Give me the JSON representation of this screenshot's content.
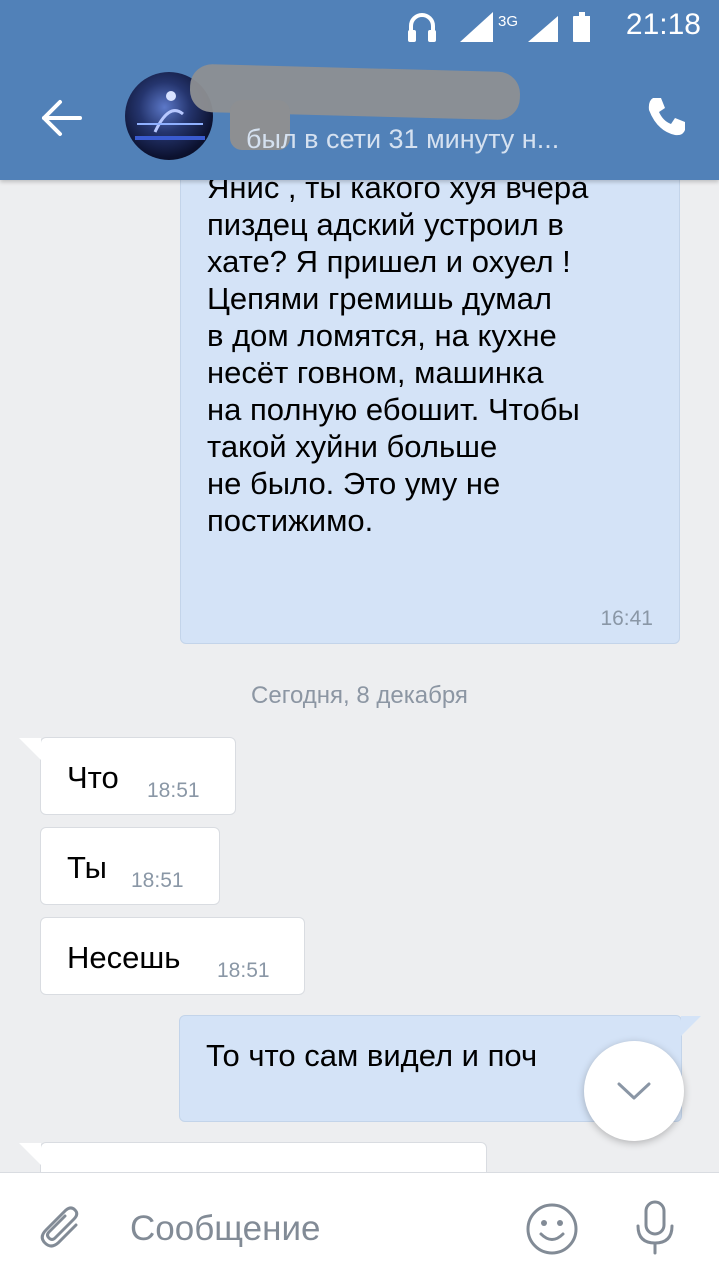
{
  "status_bar": {
    "time": "21:18",
    "network": "3G",
    "icons": [
      "headphones-icon",
      "signal-icon",
      "signal-3g-icon",
      "battery-icon"
    ]
  },
  "header": {
    "back_icon": "arrow-left-icon",
    "contact_status": "был в сети 31 минуту н...",
    "call_icon": "phone-icon"
  },
  "messages": {
    "out1": {
      "text": "Янис , ты какого хуя вчера\nпиздец адский устроил в\nхате? Я пришел и охуел !\nЦепями гремишь думал\nв дом ломятся, на кухне\nнесёт говном, машинка\nна полную ебошит. Чтобы\nтакой хуйни больше\nне было. Это уму не\nпостижимо.",
      "time": "16:41"
    },
    "date_separator": "Сегодня, 8 декабря",
    "in1": {
      "text": "Что",
      "time": "18:51"
    },
    "in2": {
      "text": "Ты",
      "time": "18:51"
    },
    "in3": {
      "text": "Несешь",
      "time": "18:51"
    },
    "out2": {
      "text": "То что сам видел и поч"
    }
  },
  "scroll_down_icon": "chevron-down-icon",
  "input_bar": {
    "placeholder": "Сообщение",
    "attach_icon": "paperclip-icon",
    "emoji_icon": "smile-icon",
    "mic_icon": "microphone-icon"
  },
  "colors": {
    "header": "#5181b8",
    "background": "#edeef0",
    "outgoing_bubble": "#d4e3f7",
    "incoming_bubble": "#ffffff",
    "icon_gray": "#828b96"
  }
}
